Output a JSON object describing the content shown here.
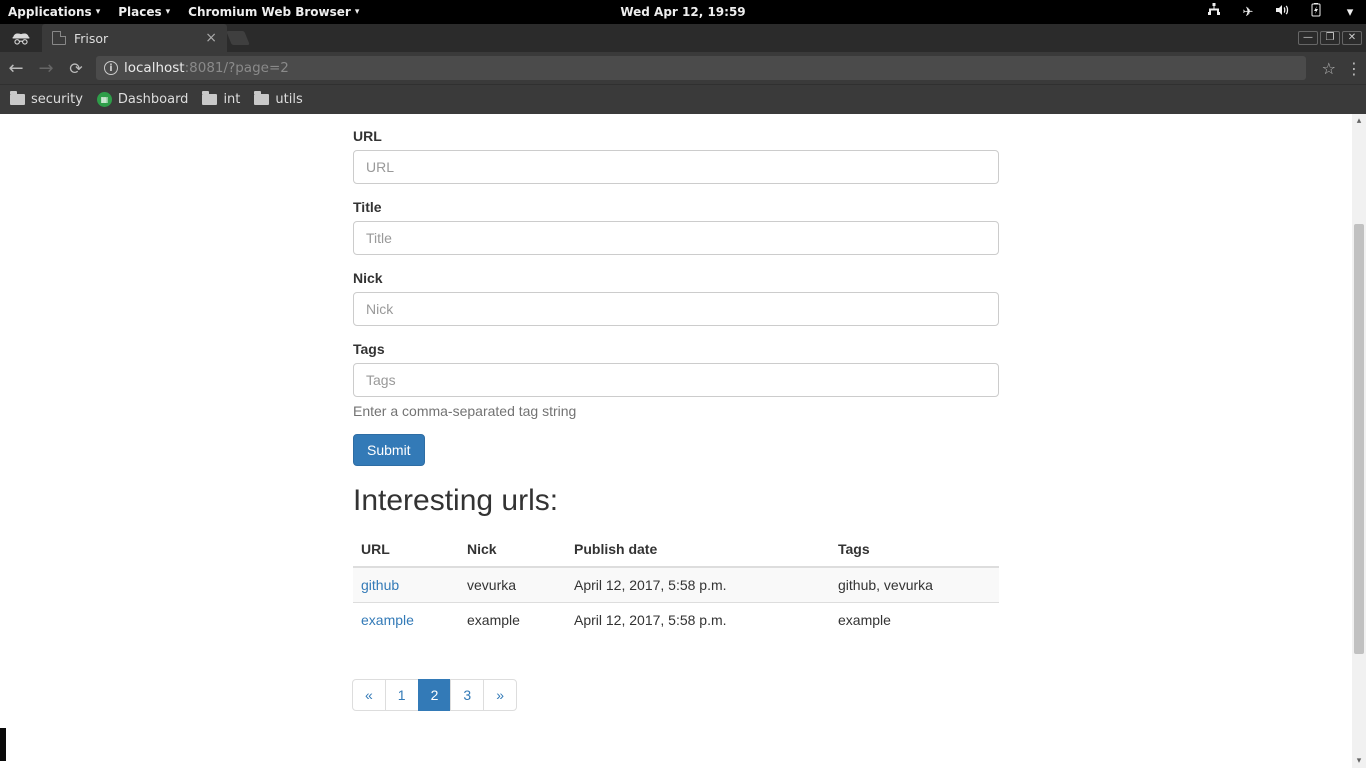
{
  "gnome": {
    "applications": "Applications",
    "places": "Places",
    "app": "Chromium Web Browser",
    "clock": "Wed Apr 12, 19:59"
  },
  "browser": {
    "tab_title": "Frisor",
    "url_host": "localhost",
    "url_rest": ":8081/?page=2",
    "bookmarks": {
      "security": "security",
      "dashboard": "Dashboard",
      "int": "int",
      "utils": "utils"
    }
  },
  "page": {
    "form": {
      "url": {
        "label": "URL",
        "placeholder": "URL"
      },
      "title": {
        "label": "Title",
        "placeholder": "Title"
      },
      "nick": {
        "label": "Nick",
        "placeholder": "Nick"
      },
      "tags": {
        "label": "Tags",
        "placeholder": "Tags",
        "help": "Enter a comma-separated tag string"
      },
      "submit": "Submit"
    },
    "section_title": "Interesting urls:",
    "headers": {
      "url": "URL",
      "nick": "Nick",
      "date": "Publish date",
      "tags": "Tags"
    },
    "rows": [
      {
        "url": "github",
        "nick": "vevurka",
        "date": "April 12, 2017, 5:58 p.m.",
        "tags": "github, vevurka"
      },
      {
        "url": "example",
        "nick": "example",
        "date": "April 12, 2017, 5:58 p.m.",
        "tags": "example"
      }
    ],
    "pagination": {
      "prev": "«",
      "p1": "1",
      "p2": "2",
      "p3": "3",
      "next": "»"
    }
  }
}
